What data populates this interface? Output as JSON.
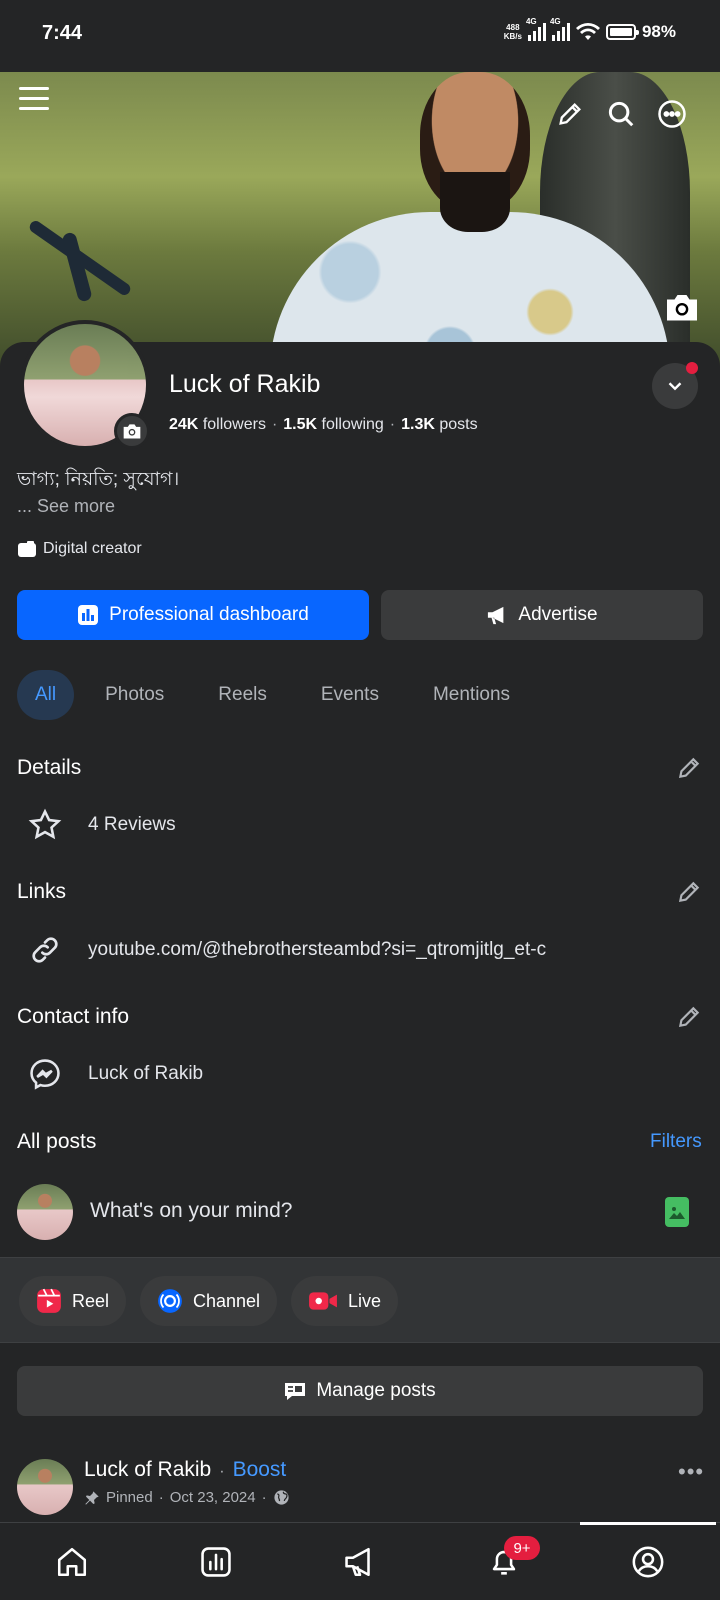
{
  "status_bar": {
    "time": "7:44",
    "net_speed_top": "488",
    "net_speed_bottom": "KB/s",
    "sig1_label": "4G",
    "sig2_label": "4G",
    "battery": "98%"
  },
  "profile": {
    "name": "Luck of Rakib",
    "followers_count": "24K",
    "followers_label": "followers",
    "following_count": "1.5K",
    "following_label": "following",
    "posts_count": "1.3K",
    "posts_label": "posts",
    "bio": "ভাগ্য; নিয়তি; সুযোগ।",
    "see_more": "... See more",
    "category": "Digital creator"
  },
  "actions": {
    "professional_dashboard": "Professional dashboard",
    "advertise": "Advertise"
  },
  "tabs": [
    {
      "label": "All",
      "active": true
    },
    {
      "label": "Photos",
      "active": false
    },
    {
      "label": "Reels",
      "active": false
    },
    {
      "label": "Events",
      "active": false
    },
    {
      "label": "Mentions",
      "active": false
    }
  ],
  "details": {
    "title": "Details",
    "reviews": "4 Reviews"
  },
  "links": {
    "title": "Links",
    "url": "youtube.com/@thebrothersteambd?si=_qtromjitlg_et-c"
  },
  "contact": {
    "title": "Contact info",
    "messenger": "Luck of Rakib"
  },
  "posts": {
    "title": "All posts",
    "filters": "Filters",
    "composer_placeholder": "What's on your mind?",
    "reel": "Reel",
    "channel": "Channel",
    "live": "Live",
    "manage": "Manage posts"
  },
  "post": {
    "author": "Luck of Rakib",
    "separator": "·",
    "boost": "Boost",
    "pinned": "Pinned",
    "date": "Oct 23, 2024"
  },
  "nav": {
    "notification_badge": "9+"
  },
  "colors": {
    "accent": "#0866ff",
    "link": "#4599ff",
    "background": "#242526",
    "badge": "#e41e3f"
  }
}
